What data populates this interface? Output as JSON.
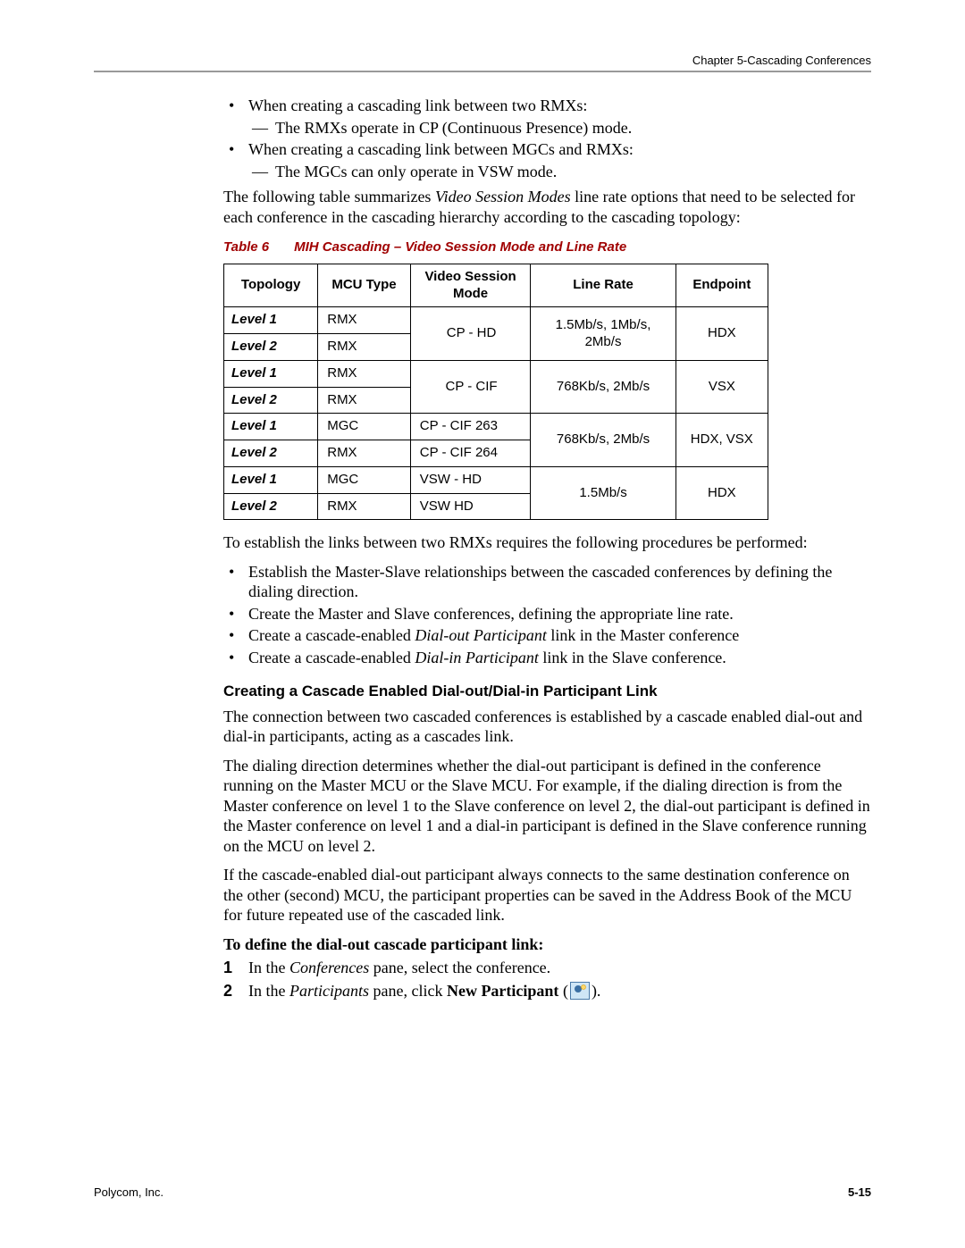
{
  "header": {
    "running_head": "Chapter 5-Cascading Conferences"
  },
  "intro_bullets": [
    {
      "text": "When creating a cascading link between two RMXs:",
      "sub": [
        "The RMXs operate in CP (Continuous Presence) mode."
      ]
    },
    {
      "text": "When creating a cascading link between MGCs and RMXs:",
      "sub": [
        "The MGCs can only operate in VSW mode."
      ]
    }
  ],
  "intro_para_pre": "The following table summarizes ",
  "intro_para_em": "Video Session Modes",
  "intro_para_post": " line rate options that need to be selected for each conference in the cascading hierarchy according to the cascading topology:",
  "table6": {
    "caption_label": "Table 6",
    "caption_title": "MIH Cascading – Video Session Mode and Line Rate",
    "headers": {
      "topology": "Topology",
      "mcu_type": "MCU Type",
      "video_session_mode": "Video Session Mode",
      "line_rate": "Line Rate",
      "endpoint": "Endpoint"
    },
    "groups": [
      {
        "rows": [
          {
            "topology": "Level 1",
            "mcu": "RMX"
          },
          {
            "topology": "Level 2",
            "mcu": "RMX"
          }
        ],
        "mode_shared": "CP - HD",
        "rate": "1.5Mb/s, 1Mb/s, 2Mb/s",
        "endpoint": "HDX"
      },
      {
        "rows": [
          {
            "topology": "Level 1",
            "mcu": "RMX"
          },
          {
            "topology": "Level 2",
            "mcu": "RMX"
          }
        ],
        "mode_shared": "CP - CIF",
        "rate": "768Kb/s, 2Mb/s",
        "endpoint": "VSX"
      },
      {
        "rows": [
          {
            "topology": "Level 1",
            "mcu": "MGC",
            "mode": "CP - CIF 263"
          },
          {
            "topology": "Level 2",
            "mcu": "RMX",
            "mode": "CP - CIF 264"
          }
        ],
        "rate": "768Kb/s, 2Mb/s",
        "endpoint": "HDX, VSX"
      },
      {
        "rows": [
          {
            "topology": "Level 1",
            "mcu": "MGC",
            "mode": "VSW - HD"
          },
          {
            "topology": "Level 2",
            "mcu": "RMX",
            "mode": "VSW HD"
          }
        ],
        "rate": "1.5Mb/s",
        "endpoint": "HDX"
      }
    ]
  },
  "after_table_para": "To establish the links between two RMXs requires the following procedures be performed:",
  "after_table_bullets": [
    {
      "text": "Establish the Master-Slave relationships between the cascaded conferences by defining the dialing direction."
    },
    {
      "text": "Create the Master and Slave conferences, defining the appropriate line rate."
    },
    {
      "pre": "Create a cascade-enabled ",
      "em": "Dial-out Participant",
      "post": " link in the Master conference"
    },
    {
      "pre": "Create a cascade-enabled ",
      "em": "Dial-in Participant",
      "post": " link in the Slave conference."
    }
  ],
  "section_h4": "Creating a Cascade Enabled Dial-out/Dial-in Participant Link",
  "para1": "The connection between two cascaded conferences is established by a cascade enabled dial-out and dial-in participants, acting as a cascades link.",
  "para2": "The dialing direction determines whether the dial-out participant is defined in the conference running on the Master MCU or the Slave MCU. For example, if the dialing direction is from the Master conference on level 1 to the Slave conference on level 2, the dial-out participant is defined in the Master conference on level 1 and a dial-in participant is defined in the Slave conference running on the MCU on level 2.",
  "para3": "If the cascade-enabled dial-out participant always connects to the same destination conference on the other (second) MCU, the participant properties can be saved in the Address Book of the MCU for future repeated use of the cascaded link.",
  "proc_heading": "To define the dial-out cascade participant link:",
  "steps": [
    {
      "pre": "In the ",
      "em": "Conferences",
      "post": " pane, select the conference."
    },
    {
      "pre": "In the ",
      "em": "Participants",
      "mid": " pane, click ",
      "bold": "New Participant",
      "post_open": " (",
      "post_close": ")."
    }
  ],
  "footer": {
    "company": "Polycom, Inc.",
    "pagenum": "5-15"
  }
}
